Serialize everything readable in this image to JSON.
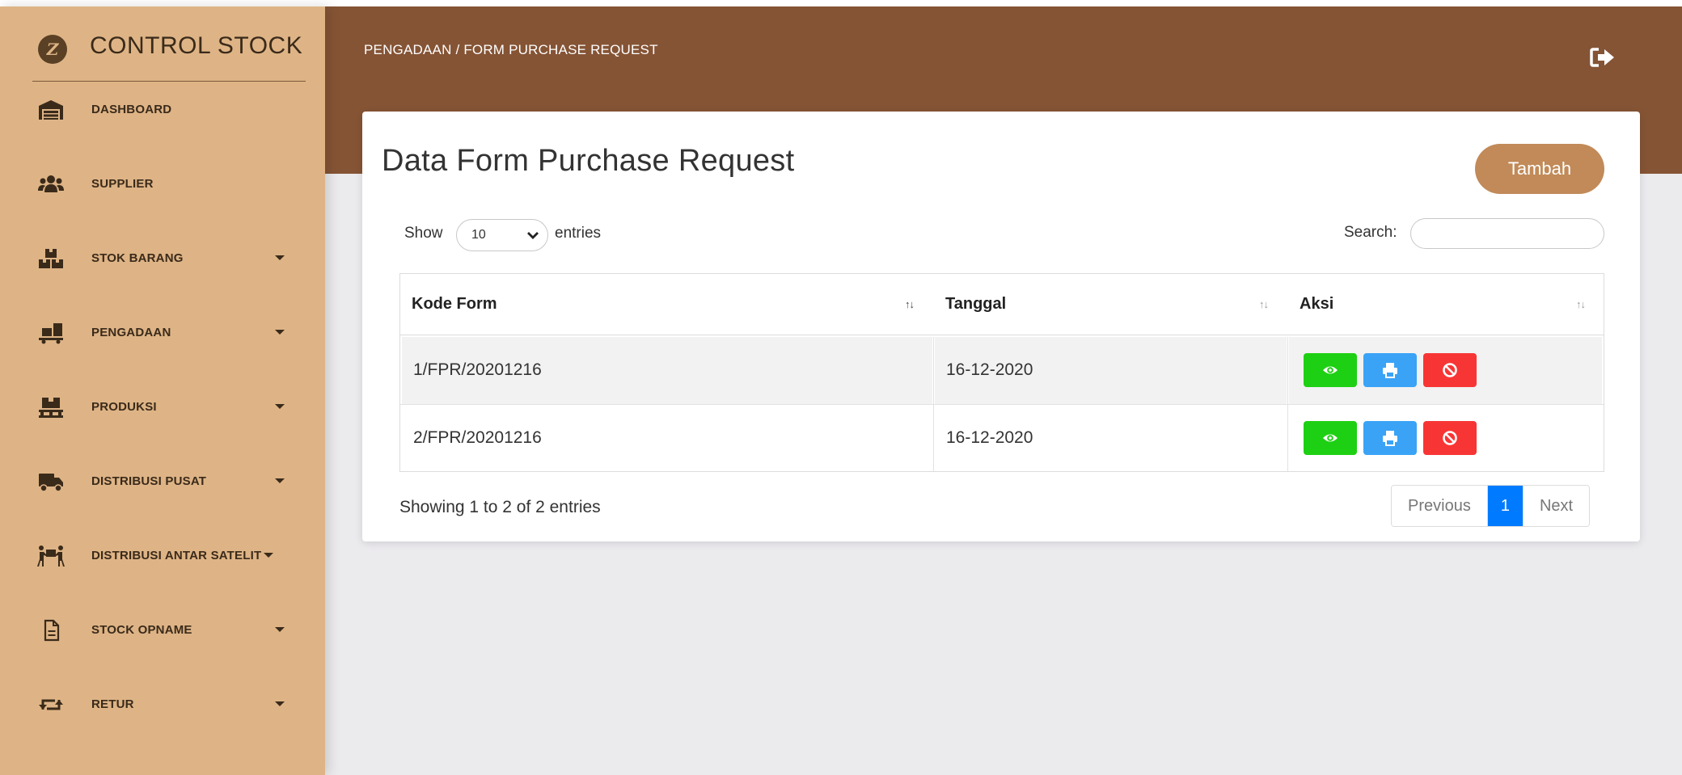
{
  "brand": {
    "name": "CONTROL STOCK",
    "logo_letter": "Z"
  },
  "sidebar": {
    "items": [
      {
        "label": "DASHBOARD",
        "icon": "warehouse-icon",
        "has_caret": false
      },
      {
        "label": "SUPPLIER",
        "icon": "users-icon",
        "has_caret": false
      },
      {
        "label": "STOK BARANG",
        "icon": "boxes-icon",
        "has_caret": true
      },
      {
        "label": "PENGADAAN",
        "icon": "dolly-icon",
        "has_caret": true
      },
      {
        "label": "PRODUKSI",
        "icon": "pallet-icon",
        "has_caret": true
      },
      {
        "label": "DISTRIBUSI PUSAT",
        "icon": "truck-icon",
        "has_caret": true
      },
      {
        "label": "DISTRIBUSI ANTAR SATELIT",
        "icon": "people-carry-icon",
        "has_caret": true
      },
      {
        "label": "STOCK OPNAME",
        "icon": "file-icon",
        "has_caret": true
      },
      {
        "label": "RETUR",
        "icon": "retweet-icon",
        "has_caret": true
      }
    ]
  },
  "header": {
    "breadcrumb": "PENGADAAN / FORM PURCHASE REQUEST",
    "logout_icon": "sign-out-icon"
  },
  "card": {
    "title": "Data Form Purchase Request",
    "add_button": "Tambah",
    "show_label": "Show",
    "entries_value": "10",
    "entries_label": "entries",
    "search_label": "Search:",
    "search_value": "",
    "table": {
      "columns": [
        "Kode Form",
        "Tanggal",
        "Aksi"
      ],
      "rows": [
        {
          "kode": "1/FPR/20201216",
          "tanggal": "16-12-2020"
        },
        {
          "kode": "2/FPR/20201216",
          "tanggal": "16-12-2020"
        }
      ],
      "actions": [
        "eye-icon",
        "print-icon",
        "ban-icon"
      ]
    },
    "info": "Showing 1 to 2 of 2 entries",
    "pagination": {
      "previous": "Previous",
      "current": "1",
      "next": "Next"
    }
  },
  "colors": {
    "sidebar_bg": "#deb486",
    "header_bg": "#855435",
    "add_button": "#c18a58",
    "view_button": "#1ed013",
    "print_button": "#3aa3f6",
    "delete_button": "#f83535",
    "page_active": "#007bff"
  }
}
